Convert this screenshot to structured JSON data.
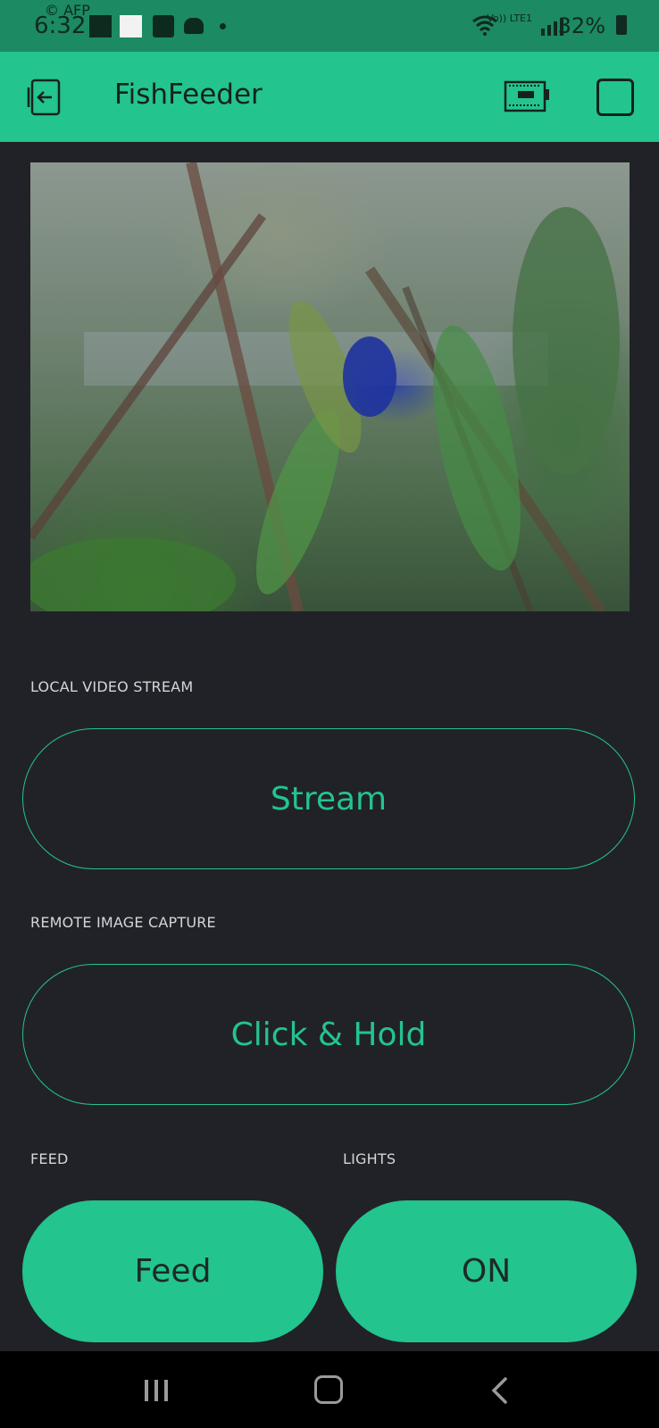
{
  "status_bar": {
    "carrier_mark": "© AFP",
    "time": "6:32",
    "network": "Vo)) LTE1",
    "battery": "32%"
  },
  "app_bar": {
    "title": "FishFeeder"
  },
  "widgets": {
    "video_label": "LOCAL VIDEO STREAM",
    "stream_button": "Stream",
    "capture_label": "REMOTE IMAGE CAPTURE",
    "capture_button": "Click & Hold",
    "feed_label": "FEED",
    "feed_button": "Feed",
    "lights_label": "LIGHTS",
    "lights_button": "ON"
  },
  "colors": {
    "accent": "#23c48e",
    "background": "#212227",
    "status_bar": "#1c8a62",
    "nav_bar": "#000000"
  },
  "icons": {
    "back": "exit-icon",
    "device": "device-board-icon",
    "square": "square-icon",
    "nav_recent": "recent-apps-icon",
    "nav_home": "home-icon",
    "nav_back": "back-chevron-icon"
  }
}
